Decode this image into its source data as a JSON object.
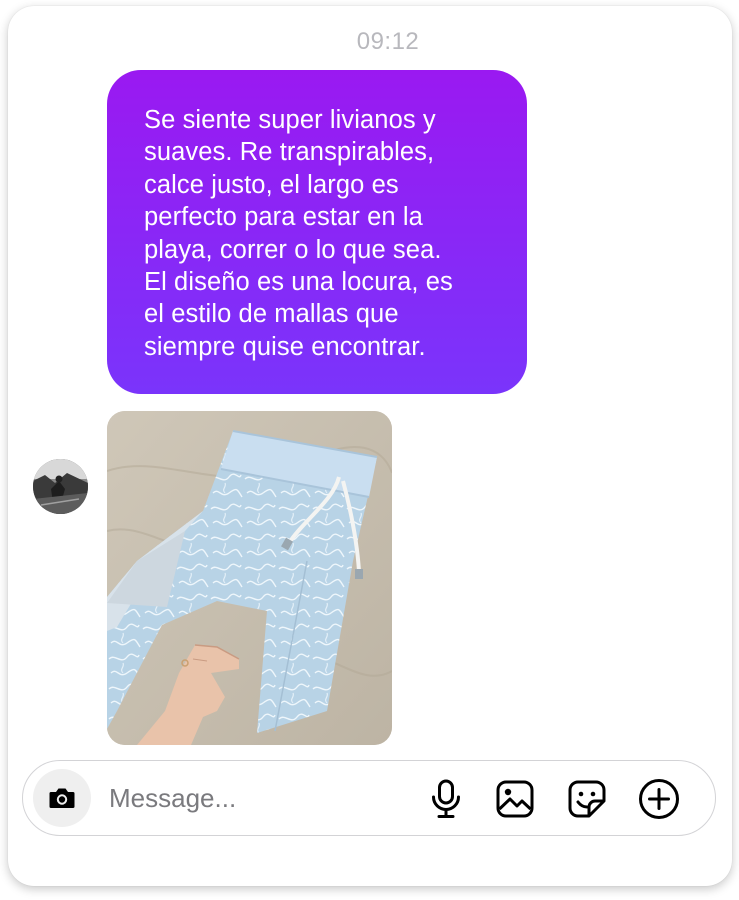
{
  "thread": {
    "timestamp": "09:12",
    "message": {
      "text": "Se siente super livianos y\nsuaves. Re transpirables,\ncalce justo, el largo es\nperfecto para estar en la\nplaya, correr o lo que sea.\nEl diseño es una locura, es\nel estilo de mallas que\nsiempre quise encontrar.",
      "bubble_colors": [
        "#9a19f1",
        "#7a34fb"
      ]
    },
    "attachment": {
      "kind": "photo",
      "subject": "light blue patterned swim shorts on linen"
    }
  },
  "composer": {
    "placeholder": "Message...",
    "icons": [
      "camera-icon",
      "microphone-icon",
      "gallery-icon",
      "sticker-icon",
      "plus-circle-icon"
    ]
  }
}
